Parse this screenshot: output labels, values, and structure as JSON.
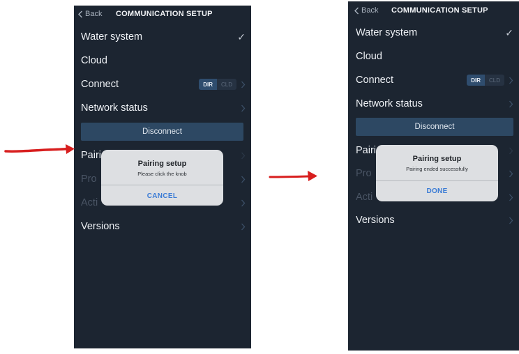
{
  "colors": {
    "screen_bg": "#1c2531",
    "accent": "#3a7bd5",
    "arrow": "#d81e1e"
  },
  "screens": [
    {
      "back_label": "Back",
      "title": "COMMUNICATION SETUP",
      "rows": {
        "water_system": "Water system",
        "cloud": "Cloud",
        "connect": "Connect",
        "network_status": "Network status",
        "pairing_partial": "Pairi",
        "provision_partial": "Pro",
        "activation_partial": "Acti",
        "versions": "Versions"
      },
      "connect_options": [
        "DIR",
        "CLD"
      ],
      "disconnect_label": "Disconnect",
      "dialog": {
        "title": "Pairing setup",
        "message": "Please click the knob",
        "button": "CANCEL"
      }
    },
    {
      "back_label": "Back",
      "title": "COMMUNICATION SETUP",
      "rows": {
        "water_system": "Water system",
        "cloud": "Cloud",
        "connect": "Connect",
        "network_status": "Network status",
        "pairing_partial": "Pairi",
        "provision_partial": "Pro",
        "activation_partial": "Acti",
        "versions": "Versions"
      },
      "connect_options": [
        "DIR",
        "CLD"
      ],
      "disconnect_label": "Disconnect",
      "dialog": {
        "title": "Pairing setup",
        "message": "Pairing ended successfully",
        "button": "DONE"
      }
    }
  ],
  "icons": {
    "back": "chevron-left-icon",
    "check": "checkmark-icon",
    "row_chevron": "chevron-right-icon",
    "annotation": "red-arrow"
  }
}
